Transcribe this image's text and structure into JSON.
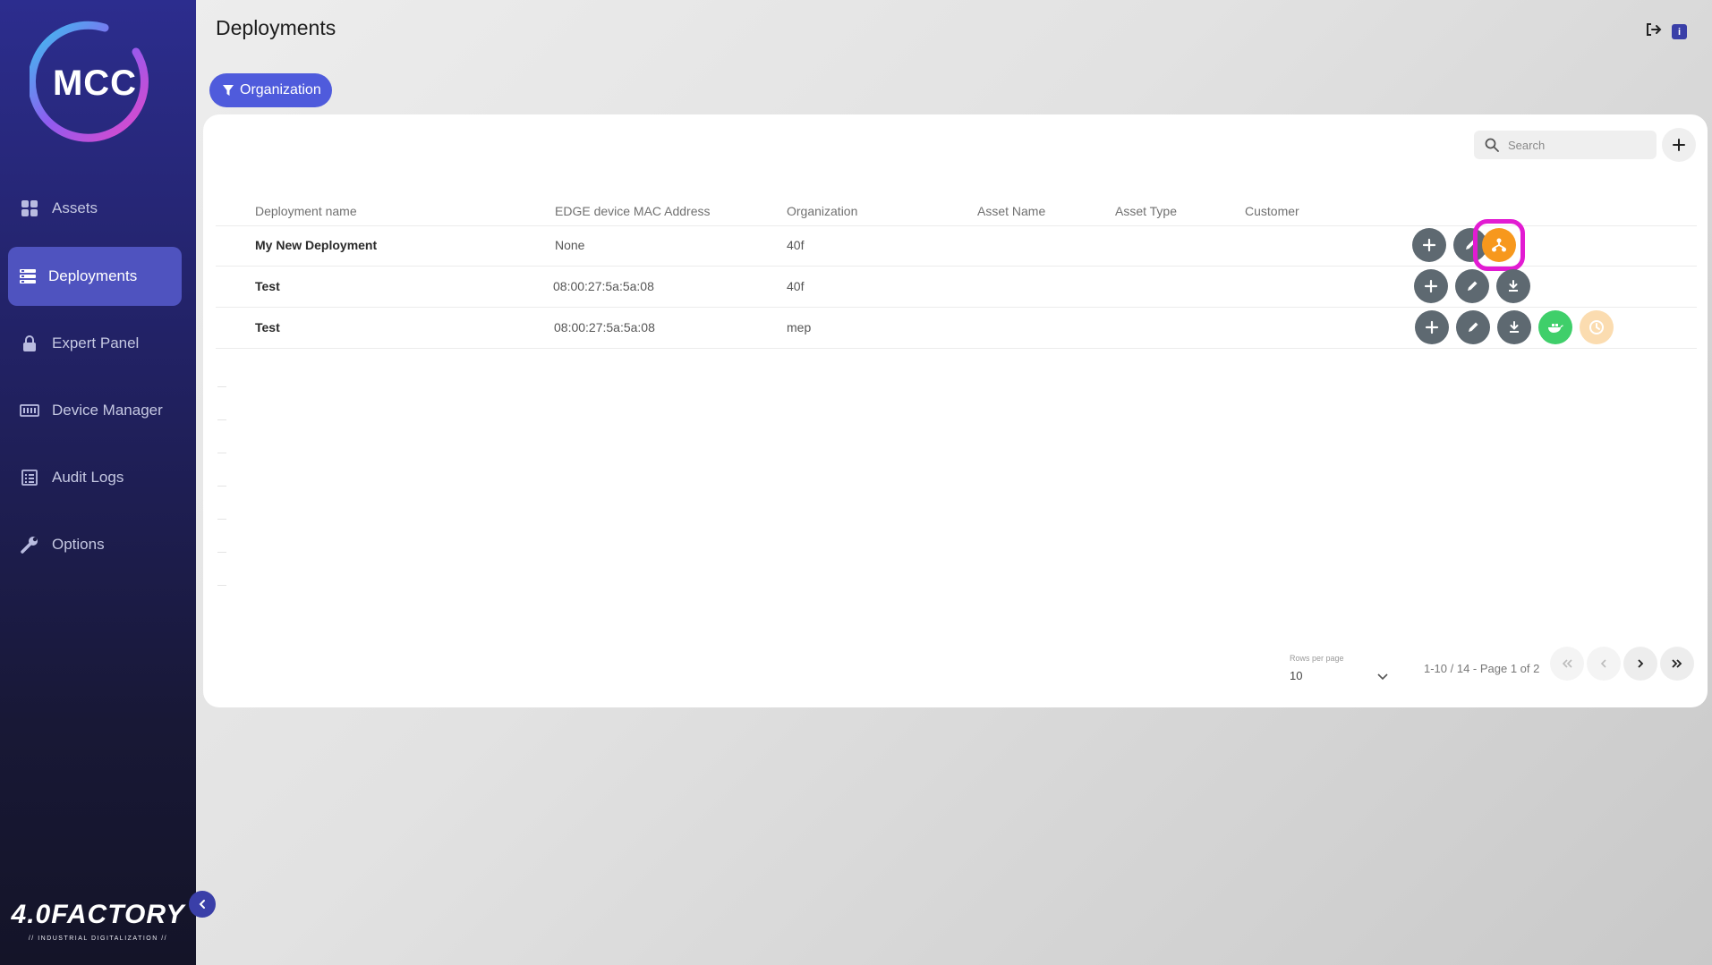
{
  "sidebar": {
    "logo_text": "MCC",
    "items": [
      {
        "label": "Assets",
        "icon": "grid-icon",
        "active": false
      },
      {
        "label": "Deployments",
        "icon": "stack-icon",
        "active": true
      },
      {
        "label": "Expert Panel",
        "icon": "lock-icon",
        "active": false
      },
      {
        "label": "Device Manager",
        "icon": "keyboard-icon",
        "active": false
      },
      {
        "label": "Audit Logs",
        "icon": "list-icon",
        "active": false
      },
      {
        "label": "Options",
        "icon": "wrench-icon",
        "active": false
      }
    ],
    "brand": "4.0FACTORY",
    "brand_sub": "// INDUSTRIAL DIGITALIZATION //"
  },
  "header": {
    "title": "Deployments",
    "info_badge": "i"
  },
  "filter": {
    "label": "Organization"
  },
  "search": {
    "placeholder": "Search",
    "value": ""
  },
  "table": {
    "columns": [
      "Deployment name",
      "EDGE device MAC Address",
      "Organization",
      "Asset Name",
      "Asset Type",
      "Customer"
    ],
    "rows": [
      {
        "name": "My New Deployment",
        "mac": "None",
        "organization": "40f",
        "asset_name": "",
        "asset_type": "",
        "customer": "",
        "actions": [
          "add",
          "edit",
          "deploy"
        ]
      },
      {
        "name": "Test",
        "mac": "08:00:27:5a:5a:08",
        "organization": "40f",
        "asset_name": "",
        "asset_type": "",
        "customer": "",
        "actions": [
          "add",
          "edit",
          "download"
        ]
      },
      {
        "name": "Test",
        "mac": "08:00:27:5a:5a:08",
        "organization": "mep",
        "asset_name": "",
        "asset_type": "",
        "customer": "",
        "actions": [
          "add",
          "edit",
          "download",
          "docker",
          "pending"
        ]
      }
    ]
  },
  "pagination": {
    "rows_per_page_label": "Rows per page",
    "rows_per_page": "10",
    "range": "1-10 / 14 - Page 1 of 2"
  },
  "colors": {
    "accent": "#4f5bdc",
    "sidebar_active": "#4f53bf",
    "action_gray": "#5e6971",
    "deploy_orange": "#f7981d",
    "docker_green": "#3fcf6a",
    "highlight_magenta": "#e21bd2"
  }
}
